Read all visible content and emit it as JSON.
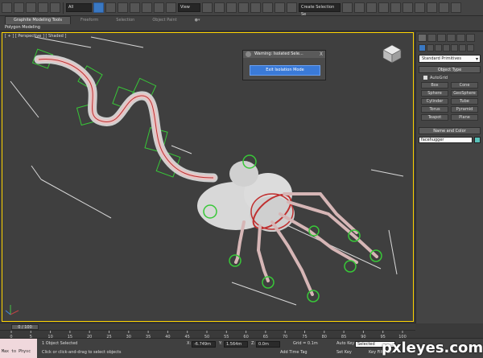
{
  "toolbar": {
    "selection_filter": "All",
    "view_dropdown": "View",
    "named_selection": "Create Selection Se"
  },
  "ribbon": {
    "tabs": [
      "Graphite Modeling Tools",
      "Freeform",
      "Selection",
      "Object Paint"
    ],
    "active_tab": "Graphite Modeling Tools",
    "sub_label": "Polygon Modeling"
  },
  "viewport": {
    "label": "[ + ] [ Perspective ] [ Shaded ]"
  },
  "warning_dialog": {
    "title": "Warning: Isolated Sele...",
    "close": "X",
    "button": "Exit Isolation Mode"
  },
  "command_panel": {
    "dropdown": "Standard Primitives",
    "object_type_title": "Object Type",
    "autogrid": "AutoGrid",
    "objects": [
      "Box",
      "Cone",
      "Sphere",
      "GeoSphere",
      "Cylinder",
      "Tube",
      "Torus",
      "Pyramid",
      "Teapot",
      "Plane"
    ],
    "name_color_title": "Name and Color",
    "name_value": "facehugger",
    "swatch_color": "#58c0b8"
  },
  "timeline": {
    "frame": "0 / 100",
    "ticks": [
      "0",
      "5",
      "10",
      "15",
      "20",
      "25",
      "30",
      "35",
      "40",
      "45",
      "50",
      "55",
      "60",
      "65",
      "70",
      "75",
      "80",
      "85",
      "90",
      "95",
      "100"
    ]
  },
  "status": {
    "maxscript": "Max to Physc",
    "line1": "1 Object Selected",
    "line2": "Click or click-and-drag to select objects",
    "x_label": "X:",
    "x_value": "-6.749m",
    "y_label": "Y:",
    "y_value": "1.564m",
    "z_label": "Z:",
    "z_value": "0.0m",
    "grid": "Grid = 0.1m",
    "add_time_tag": "Add Time Tag",
    "auto_key": "Auto Key",
    "selected": "Selected",
    "set_key": "Set Key",
    "key_filters": "Key Filters..."
  },
  "watermark": "pxleyes.com",
  "colors": {
    "accent": "#3a78c2",
    "viewport_border": "#ffd400",
    "helper_green": "#38c838",
    "bone_red": "#c03030"
  }
}
